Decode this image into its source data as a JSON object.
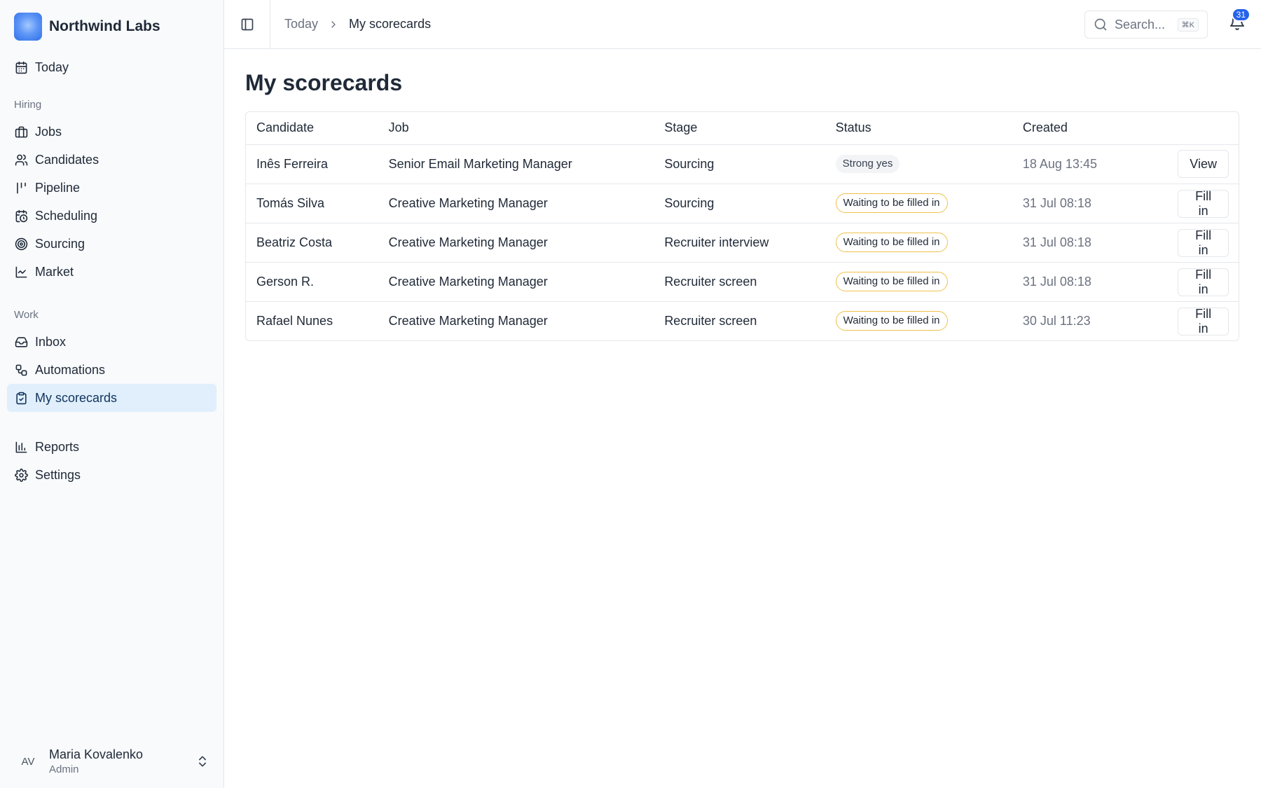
{
  "brand": {
    "name": "Northwind Labs"
  },
  "sidebar": {
    "top": [
      {
        "label": "Today",
        "icon": "calendar-icon"
      }
    ],
    "hiring_label": "Hiring",
    "hiring": [
      {
        "label": "Jobs",
        "icon": "briefcase-icon"
      },
      {
        "label": "Candidates",
        "icon": "users-icon"
      },
      {
        "label": "Pipeline",
        "icon": "pipeline-icon"
      },
      {
        "label": "Scheduling",
        "icon": "calendar-clock-icon"
      },
      {
        "label": "Sourcing",
        "icon": "radar-icon"
      },
      {
        "label": "Market",
        "icon": "line-chart-icon"
      }
    ],
    "work_label": "Work",
    "work": [
      {
        "label": "Inbox",
        "icon": "inbox-icon"
      },
      {
        "label": "Automations",
        "icon": "workflow-icon"
      },
      {
        "label": "My scorecards",
        "icon": "clipboard-check-icon",
        "active": true
      }
    ],
    "bottom": [
      {
        "label": "Reports",
        "icon": "bar-chart-icon"
      },
      {
        "label": "Settings",
        "icon": "gear-icon"
      }
    ],
    "user": {
      "initials": "AV",
      "name": "Maria Kovalenko",
      "role": "Admin"
    }
  },
  "topbar": {
    "breadcrumb": {
      "parent": "Today",
      "current": "My scorecards"
    },
    "search": {
      "placeholder": "Search...",
      "shortcut": "⌘K"
    },
    "notifications": {
      "count": "31"
    }
  },
  "page": {
    "title": "My scorecards"
  },
  "table": {
    "headers": {
      "candidate": "Candidate",
      "job": "Job",
      "stage": "Stage",
      "status": "Status",
      "created": "Created"
    },
    "rows": [
      {
        "candidate": "Inês Ferreira",
        "job": "Senior Email Marketing Manager",
        "stage": "Sourcing",
        "status": "Strong yes",
        "status_type": "strong",
        "created": "18 Aug 13:45",
        "action": "View"
      },
      {
        "candidate": "Tomás Silva",
        "job": "Creative Marketing Manager",
        "stage": "Sourcing",
        "status": "Waiting to be filled in",
        "status_type": "waiting",
        "created": "31 Jul 08:18",
        "action": "Fill in"
      },
      {
        "candidate": "Beatriz Costa",
        "job": "Creative Marketing Manager",
        "stage": "Recruiter interview",
        "status": "Waiting to be filled in",
        "status_type": "waiting",
        "created": "31 Jul 08:18",
        "action": "Fill in"
      },
      {
        "candidate": "Gerson R.",
        "job": "Creative Marketing Manager",
        "stage": "Recruiter screen",
        "status": "Waiting to be filled in",
        "status_type": "waiting",
        "created": "31 Jul 08:18",
        "action": "Fill in"
      },
      {
        "candidate": "Rafael Nunes",
        "job": "Creative Marketing Manager",
        "stage": "Recruiter screen",
        "status": "Waiting to be filled in",
        "status_type": "waiting",
        "created": "30 Jul 11:23",
        "action": "Fill in"
      }
    ]
  },
  "colors": {
    "accent": "#2563eb",
    "active_bg": "#e0effb",
    "waiting_border": "#f0c14b"
  }
}
